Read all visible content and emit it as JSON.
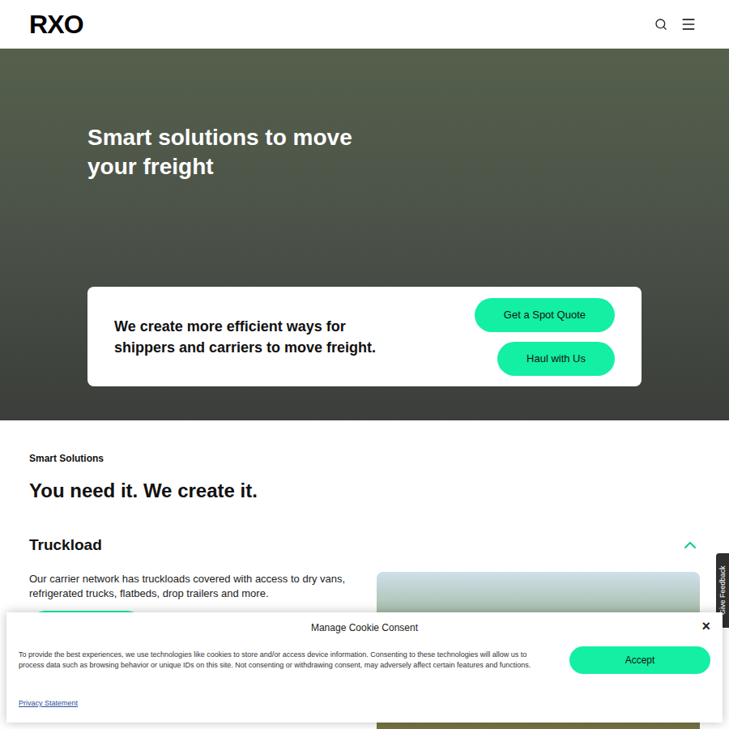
{
  "header": {
    "logo": "RXO"
  },
  "hero": {
    "heading": "Smart solutions to move your freight",
    "card_text": "We create more efficient ways for shippers and carriers to move freight.",
    "buttons": [
      "Get a Spot Quote",
      "Haul with Us"
    ]
  },
  "section": {
    "eyebrow": "Smart Solutions",
    "title": "You need it. We create it.",
    "accordion": [
      {
        "title": "Truckload",
        "expanded": true,
        "text": "Our carrier network has truckloads covered with access to dry vans, refrigerated trucks, flatbeds, drop trailers and more."
      }
    ]
  },
  "feedback_tab": {
    "label": "Give Feedback"
  },
  "cookie_banner": {
    "title": "Manage Cookie Consent",
    "close": "×",
    "text": "To provide the best experiences, we use technologies like cookies to store and/or access device information. Consenting to these technologies will allow us to process data such as browsing behavior or unique IDs on this site. Not consenting or withdrawing consent, may adversely affect certain features and functions.",
    "accept": "Accept",
    "link": "Privacy Statement"
  }
}
